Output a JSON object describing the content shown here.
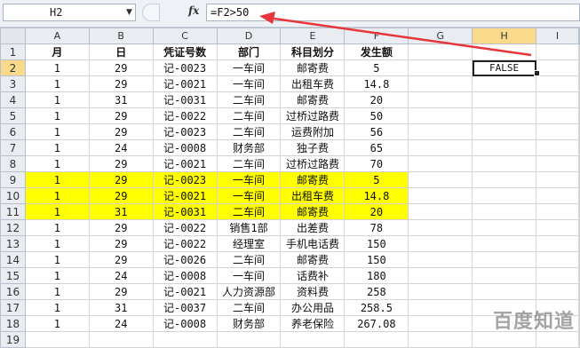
{
  "formula_bar": {
    "name_box": "H2",
    "fx_label": "fx",
    "formula": "=F2>50"
  },
  "columns": [
    "A",
    "B",
    "C",
    "D",
    "E",
    "F",
    "G",
    "H",
    "I"
  ],
  "selected_cell": {
    "column": "H",
    "row": "2",
    "value": "FALSE"
  },
  "rows": [
    {
      "n": "1",
      "cells": [
        "月",
        "日",
        "凭证号数",
        "部门",
        "科目划分",
        "发生额"
      ],
      "header": true
    },
    {
      "n": "2",
      "cells": [
        "1",
        "29",
        "记-0023",
        "一车间",
        "邮寄费",
        "5"
      ]
    },
    {
      "n": "3",
      "cells": [
        "1",
        "29",
        "记-0021",
        "一车间",
        "出租车费",
        "14.8"
      ]
    },
    {
      "n": "4",
      "cells": [
        "1",
        "31",
        "记-0031",
        "二车间",
        "邮寄费",
        "20"
      ]
    },
    {
      "n": "5",
      "cells": [
        "1",
        "29",
        "记-0022",
        "二车间",
        "过桥过路费",
        "50"
      ]
    },
    {
      "n": "6",
      "cells": [
        "1",
        "29",
        "记-0023",
        "二车间",
        "运费附加",
        "56"
      ]
    },
    {
      "n": "7",
      "cells": [
        "1",
        "24",
        "记-0008",
        "财务部",
        "独子费",
        "65"
      ]
    },
    {
      "n": "8",
      "cells": [
        "1",
        "29",
        "记-0021",
        "二车间",
        "过桥过路费",
        "70"
      ]
    },
    {
      "n": "9",
      "cells": [
        "1",
        "29",
        "记-0023",
        "一车间",
        "邮寄费",
        "5"
      ],
      "highlight": true
    },
    {
      "n": "10",
      "cells": [
        "1",
        "29",
        "记-0021",
        "一车间",
        "出租车费",
        "14.8"
      ],
      "highlight": true
    },
    {
      "n": "11",
      "cells": [
        "1",
        "31",
        "记-0031",
        "二车间",
        "邮寄费",
        "20"
      ],
      "highlight": true
    },
    {
      "n": "12",
      "cells": [
        "1",
        "29",
        "记-0022",
        "销售1部",
        "出差费",
        "78"
      ]
    },
    {
      "n": "13",
      "cells": [
        "1",
        "29",
        "记-0022",
        "经理室",
        "手机电话费",
        "150"
      ]
    },
    {
      "n": "14",
      "cells": [
        "1",
        "29",
        "记-0026",
        "二车间",
        "邮寄费",
        "150"
      ]
    },
    {
      "n": "15",
      "cells": [
        "1",
        "24",
        "记-0008",
        "一车间",
        "话费补",
        "180"
      ]
    },
    {
      "n": "16",
      "cells": [
        "1",
        "29",
        "记-0021",
        "人力资源部",
        "资料费",
        "258"
      ]
    },
    {
      "n": "17",
      "cells": [
        "1",
        "31",
        "记-0037",
        "二车间",
        "办公用品",
        "258.5"
      ]
    },
    {
      "n": "18",
      "cells": [
        "1",
        "24",
        "记-0008",
        "财务部",
        "养老保险",
        "267.08"
      ]
    },
    {
      "n": "19",
      "cells": [
        "",
        "",
        "",
        "",
        "",
        ""
      ]
    }
  ],
  "watermark": "百度知道",
  "colors": {
    "highlight": "#ffff00",
    "selected_header": "#f9d98a",
    "annotation_arrow": "#e8353a"
  }
}
